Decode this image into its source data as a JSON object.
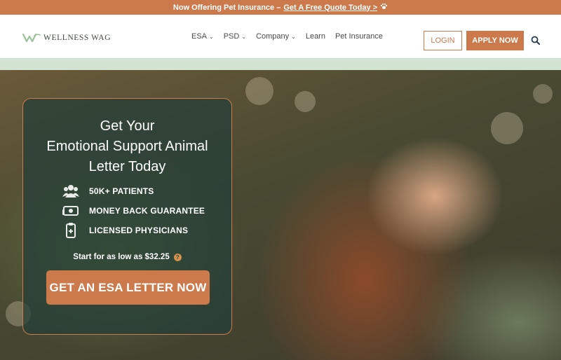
{
  "promo_bar": {
    "text": "Now Offering Pet Insurance –",
    "cta": "Get A Free Quote Today >",
    "icon": "paw-icon"
  },
  "header": {
    "logo_text": "WELLNESS WAG",
    "nav": [
      {
        "label": "ESA",
        "has_dropdown": true
      },
      {
        "label": "PSD",
        "has_dropdown": true
      },
      {
        "label": "Company",
        "has_dropdown": true
      },
      {
        "label": "Learn",
        "has_dropdown": false
      },
      {
        "label": "Pet Insurance",
        "has_dropdown": false
      }
    ],
    "login_label": "LOGIN",
    "apply_label": "APPLY NOW",
    "search_icon": "search-icon"
  },
  "hero": {
    "title_lines": [
      "Get Your",
      "Emotional Support Animal",
      "Letter Today"
    ],
    "features": [
      {
        "icon": "patients-icon",
        "label": "50K+ PATIENTS"
      },
      {
        "icon": "money-icon",
        "label": "MONEY BACK GUARANTEE"
      },
      {
        "icon": "clipboard-icon",
        "label": "LICENSED PHYSICIANS"
      }
    ],
    "price_text": "Start for as low as $32.25",
    "help_glyph": "?",
    "cta_label": "GET AN ESA LETTER NOW"
  },
  "colors": {
    "accent": "#cc7a4c",
    "green_strip": "#d2e3d1",
    "card_bg": "#223e37"
  }
}
